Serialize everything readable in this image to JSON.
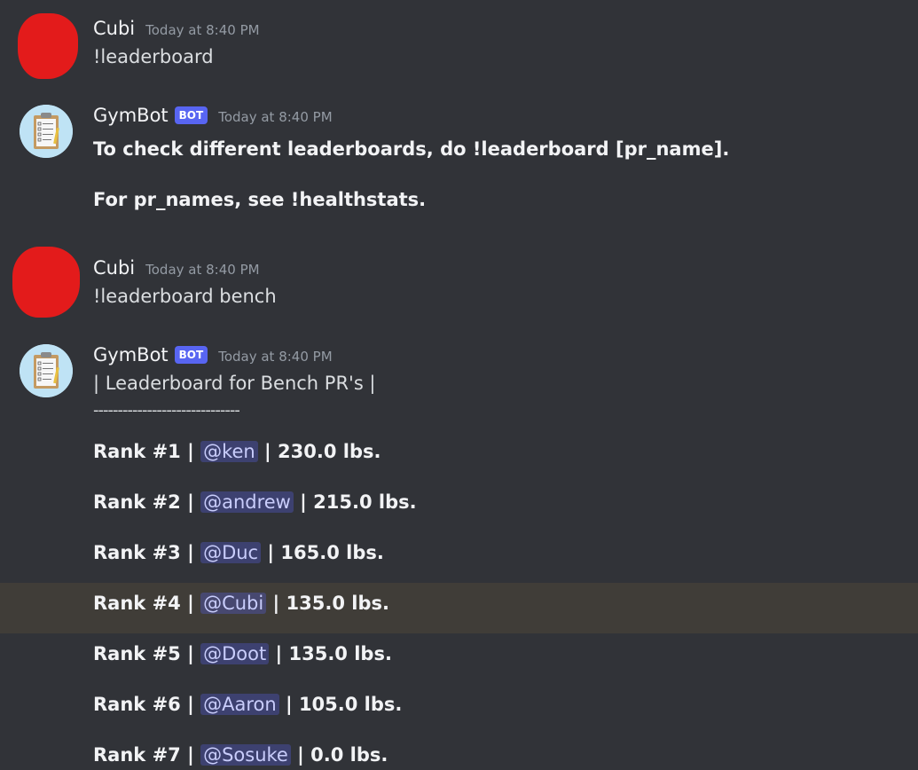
{
  "messages": [
    {
      "author": "Cubi",
      "timestamp": "Today at 8:40 PM",
      "text": "!leaderboard"
    },
    {
      "author": "GymBot",
      "bot_tag": "BOT",
      "timestamp": "Today at 8:40 PM",
      "line1": "To check different leaderboards, do !leaderboard [pr_name].",
      "line2": "For pr_names, see !healthstats."
    },
    {
      "author": "Cubi",
      "timestamp": "Today at 8:40 PM",
      "text": "!leaderboard bench"
    },
    {
      "author": "GymBot",
      "bot_tag": "BOT",
      "timestamp": "Today at 8:40 PM",
      "title": "| Leaderboard for Bench PR's |",
      "divider": "------------------------------",
      "ranks": [
        {
          "rank": "Rank #1 |",
          "user": "@ken",
          "value": "| 230.0 lbs."
        },
        {
          "rank": "Rank #2 |",
          "user": "@andrew",
          "value": "| 215.0 lbs."
        },
        {
          "rank": "Rank #3 |",
          "user": "@Duc",
          "value": "| 165.0 lbs."
        },
        {
          "rank": "Rank #4 |",
          "user": "@Cubi",
          "value": "| 135.0 lbs."
        },
        {
          "rank": "Rank #5 |",
          "user": "@Doot",
          "value": "| 135.0 lbs."
        },
        {
          "rank": "Rank #6 |",
          "user": "@Aaron",
          "value": "| 105.0 lbs."
        },
        {
          "rank": "Rank #7 |",
          "user": "@Sosuke",
          "value": "| 0.0 lbs."
        }
      ]
    }
  ],
  "colors": {
    "background": "#313338",
    "highlight": "#403d38",
    "bot_tag": "#5865f2",
    "mention_bg": "#3c4270",
    "redacted": "#e31b1b"
  }
}
